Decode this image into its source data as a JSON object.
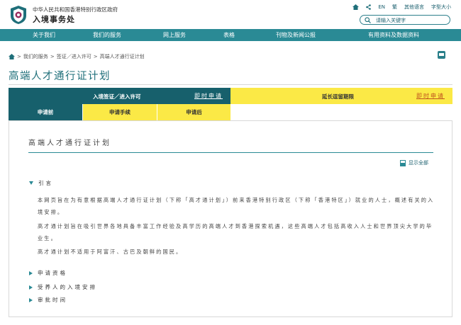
{
  "header": {
    "dept_line1": "中华人民共和国香港特别行政区政府",
    "dept_line2": "入境事务处",
    "top_links": {
      "lang_en": "EN",
      "lang_trad": "繁",
      "other_lang": "其他语言",
      "font_size": "字型大小"
    },
    "search_placeholder": "请输入关键字"
  },
  "nav": [
    "关于我们",
    "我们的服务",
    "网上服务",
    "表格",
    "刊物及新闻公报",
    "有用资料及数据资料"
  ],
  "breadcrumb": [
    "我们的服务",
    "签证／进入许可",
    "高端人才通行证计划"
  ],
  "page_title": "高端人才通行证计划",
  "tabs": {
    "left_title": "入境签证／进入许可",
    "left_link": "即时申请",
    "right_title": "延长逗留期限",
    "right_link": "即时申请",
    "subtabs": [
      "申请前",
      "申请手续",
      "申请后"
    ]
  },
  "content": {
    "section_title": "高端人才通行证计划",
    "show_all": "显示全部",
    "intro_heading": "引言",
    "paragraphs": [
      "本网页旨在为有意根据高端人才通行证计划（下称「高才通计划」）前来香港特别行政区（下称「香港特区」）就业的人士，概述有关的入境安排。",
      "高才通计划旨在吸引世界各地具备丰富工作经验及高学历的高端人才到香港探索机遇，这些高端人才包括高收入人士和世界顶尖大学的毕业生。",
      "高才通计划不适用于阿富汗、古巴及朝鲜的国民。"
    ],
    "collapsed_items": [
      "申请资格",
      "受养人的入境安排",
      "审批时间"
    ]
  }
}
